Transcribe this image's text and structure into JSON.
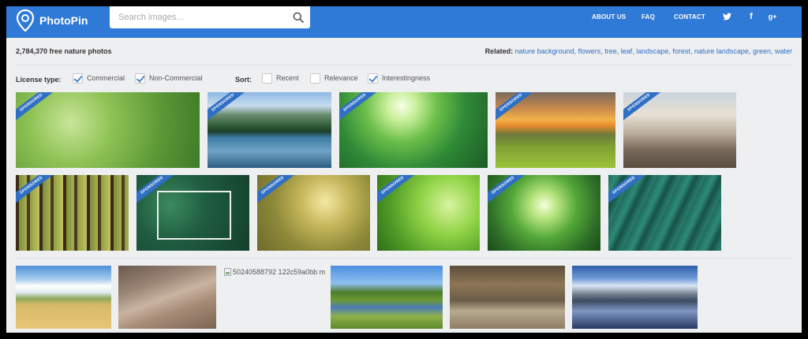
{
  "header": {
    "brand": "PhotoPin",
    "search_placeholder": "Search images...",
    "nav": {
      "about": "ABOUT US",
      "faq": "FAQ",
      "contact": "CONTACT"
    },
    "social": [
      "twitter-icon",
      "facebook-icon",
      "google-plus-icon"
    ],
    "googleplus_glyph": "g+",
    "facebook_glyph": "f"
  },
  "info": {
    "count": "2,784,370 free nature photos",
    "related_label": "Related:",
    "related": [
      "nature background",
      "flowers",
      "tree",
      "leaf",
      "landscape",
      "forest",
      "nature landscape",
      "green",
      "water"
    ]
  },
  "filters": {
    "license_label": "License type:",
    "license_options": [
      {
        "label": "Commercial",
        "checked": true
      },
      {
        "label": "Non-Commercial",
        "checked": true
      }
    ],
    "sort_label": "Sort:",
    "sort_options": [
      {
        "label": "Recent",
        "checked": false
      },
      {
        "label": "Relevance",
        "checked": false
      },
      {
        "label": "Interestingness",
        "checked": true
      }
    ]
  },
  "sponsored_label": "SPONSORED",
  "broken_image_alt": "50240588792 122c59a0bb m",
  "colors": {
    "header": "#2f7ad6",
    "ribbon": "#2f6fc4",
    "link": "#2f6fc4"
  }
}
